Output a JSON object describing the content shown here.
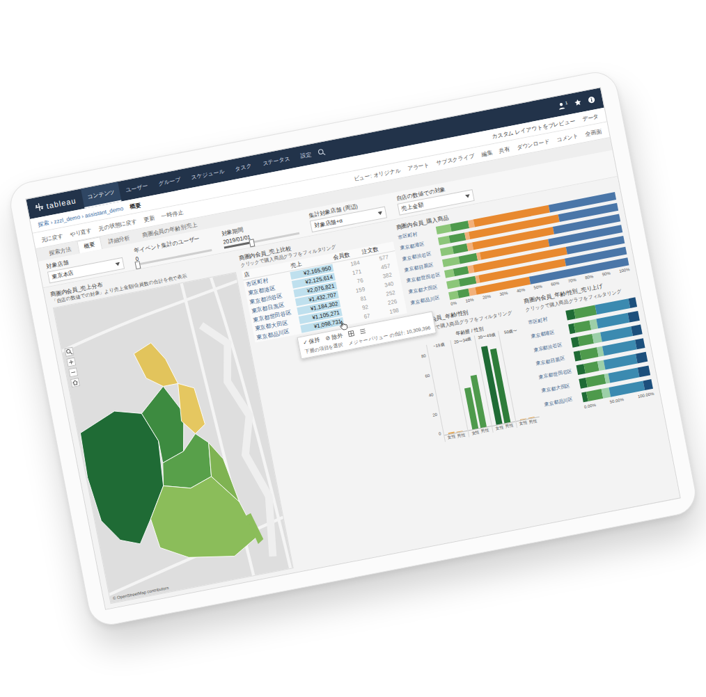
{
  "header": {
    "logo": "tableau",
    "nav": [
      {
        "label": "コンテンツ",
        "selected": true
      },
      {
        "label": "ユーザー",
        "selected": false
      },
      {
        "label": "グループ",
        "selected": false
      },
      {
        "label": "スケジュール",
        "selected": false
      },
      {
        "label": "タスク",
        "selected": false
      },
      {
        "label": "ステータス",
        "selected": false
      },
      {
        "label": "設定",
        "selected": false
      }
    ],
    "user_badge": "1"
  },
  "breadcrumb": {
    "path": "探索 › zzzl_demo › assistant_demo",
    "view": "概要"
  },
  "toolbar": {
    "left": [
      "元に戻す",
      "やり直す",
      "元の状態に戻す",
      "更新",
      "一時停止"
    ],
    "right": [
      "ビュー: オリジナル",
      "アラート",
      "サブスクライブ",
      "編集",
      "共有",
      "ダウンロード",
      "コメント",
      "全画面"
    ],
    "top_right": [
      "カスタム レイアウトをプレビュー",
      "データ"
    ]
  },
  "sheet_tabs": [
    {
      "label": "探索方法",
      "selected": false
    },
    {
      "label": "概要",
      "selected": true
    },
    {
      "label": "詳細分析",
      "selected": false
    },
    {
      "label": "商圏会員の年齢別売上",
      "selected": false
    }
  ],
  "filters": [
    {
      "kind": "dropdown",
      "label": "対象店舗",
      "value": "東京本店"
    },
    {
      "kind": "slider",
      "label": "年イベント集計のユーザー",
      "value": "0",
      "level": 0.0
    },
    {
      "kind": "slider",
      "label": "対象期間",
      "value": "2019/01/01",
      "level": 0.35
    },
    {
      "kind": "dropdown",
      "label": "集計対象店舗 (周辺)",
      "value": "対象店舗+α"
    },
    {
      "kind": "dropdown",
      "label": "自店の数値での対象",
      "value": "売上金額"
    }
  ],
  "map": {
    "title": "商圏内会員_売上分布",
    "subtitle": "「自店の数値での対象」より売上金額/会員数の合計を色で表示",
    "regions": [
      {
        "color": "#1f6b35"
      },
      {
        "color": "#3d8b40"
      },
      {
        "color": "#e2c45c"
      },
      {
        "color": "#e5c760"
      },
      {
        "color": "#58a04a"
      },
      {
        "color": "#8bbd5a"
      },
      {
        "color": "#7fb352"
      }
    ],
    "credit": "© OpenStreetMap contributors"
  },
  "table": {
    "title": "商圏内会員_売上比較",
    "subtitle": "クリックで購入商品グラフをフィルタリング",
    "columns": [
      "店",
      "売上",
      "会員数",
      "注文数"
    ],
    "rows": [
      {
        "name": "市区町村",
        "sales": "¥2,165,950",
        "members": "184",
        "orders": "577",
        "selected": true
      },
      {
        "name": "東京都港区",
        "sales": "¥2,125,614",
        "members": "171",
        "orders": "457",
        "selected": true
      },
      {
        "name": "東京都渋谷区",
        "sales": "¥2,076,821",
        "members": "76",
        "orders": "382",
        "selected": true
      },
      {
        "name": "東京都目黒区",
        "sales": "¥1,432,707",
        "members": "159",
        "orders": "340",
        "selected": true
      },
      {
        "name": "東京都世田谷区",
        "sales": "¥1,184,302",
        "members": "81",
        "orders": "252",
        "selected": true
      },
      {
        "name": "東京都大田区",
        "sales": "¥1,105,271",
        "members": "92",
        "orders": "226",
        "selected": true
      },
      {
        "name": "東京都品川区",
        "sales": "¥1,098,731",
        "members": "67",
        "orders": "198",
        "selected": true
      }
    ]
  },
  "tooltip": {
    "actions": [
      "✓ 保持",
      "⊘ 除外"
    ],
    "hint": "下層の項目を選択",
    "summary": "メジャー バリュー の合計: 10,309,396"
  },
  "purchase_chart": {
    "title": "商圏内会員_購入商品",
    "series": [
      {
        "color": "#8cc679"
      },
      {
        "color": "#4e9a4c"
      },
      {
        "color": "#f2b07a"
      },
      {
        "color": "#e8892f"
      },
      {
        "color": "#4a76a8"
      }
    ],
    "rows": [
      {
        "label": "市区町村",
        "values": [
          8,
          10,
          3,
          42,
          37
        ]
      },
      {
        "label": "東京都港区",
        "values": [
          6,
          9,
          2,
          50,
          33
        ]
      },
      {
        "label": "東京都渋谷区",
        "values": [
          7,
          8,
          3,
          45,
          37
        ]
      },
      {
        "label": "東京都目黒区",
        "values": [
          9,
          10,
          2,
          38,
          41
        ]
      },
      {
        "label": "東京都世田谷区",
        "values": [
          5,
          8,
          3,
          52,
          32
        ]
      },
      {
        "label": "東京都大田区",
        "values": [
          7,
          9,
          2,
          48,
          34
        ]
      },
      {
        "label": "東京都品川区",
        "values": [
          5,
          6,
          4,
          30,
          55
        ]
      }
    ],
    "ticks": [
      "0%",
      "10%",
      "20%",
      "30%",
      "40%",
      "50%",
      "60%",
      "70%",
      "80%",
      "90%",
      "100%"
    ]
  },
  "age_chart": {
    "title": "商圏内会員_年齢/性別",
    "subtitle": "クリックで購入商品グラフをフィルタリング",
    "axis_title": "年齢層 / 性別",
    "y_ticks": [
      "80",
      "60",
      "40",
      "20",
      "0"
    ],
    "max": 100,
    "groups": [
      {
        "label": "~19歳",
        "bars": [
          {
            "label": "女性",
            "value": 2,
            "color": "#e3a857"
          },
          {
            "label": "男性",
            "value": 1,
            "color": "#e3a857"
          }
        ]
      },
      {
        "label": "20〜34歳",
        "bars": [
          {
            "label": "女性",
            "value": 50,
            "color": "#4e9a4c"
          },
          {
            "label": "男性",
            "value": 63,
            "color": "#4e9a4c"
          }
        ]
      },
      {
        "label": "35〜49歳",
        "bars": [
          {
            "label": "女性",
            "value": 95,
            "color": "#1f6b35"
          },
          {
            "label": "男性",
            "value": 90,
            "color": "#2e7d3a"
          }
        ]
      },
      {
        "label": "50歳〜",
        "bars": [
          {
            "label": "女性",
            "value": 1,
            "color": "#e3a857"
          },
          {
            "label": "男性",
            "value": 1,
            "color": "#e3a857"
          }
        ]
      }
    ]
  },
  "age_sales_chart": {
    "title": "商圏内会員_年齢/性別_売り上げ",
    "subtitle": "クリックで購入商品グラフをフィルタリング",
    "series": [
      {
        "color": "#1f6b35"
      },
      {
        "color": "#4e9a4c"
      },
      {
        "color": "#9ccfa8"
      },
      {
        "color": "#3b8ab0"
      },
      {
        "color": "#1c4f7c"
      }
    ],
    "rows": [
      {
        "label": "市区町村",
        "values": [
          12,
          30,
          0,
          48,
          10
        ]
      },
      {
        "label": "東京都港区",
        "values": [
          8,
          22,
          10,
          45,
          15
        ]
      },
      {
        "label": "東京都渋谷区",
        "values": [
          10,
          20,
          12,
          44,
          14
        ]
      },
      {
        "label": "東京都目黒区",
        "values": [
          9,
          24,
          8,
          47,
          12
        ]
      },
      {
        "label": "東京都世田谷区",
        "values": [
          11,
          19,
          9,
          46,
          15
        ]
      },
      {
        "label": "東京都大田区",
        "values": [
          10,
          26,
          6,
          42,
          16
        ]
      },
      {
        "label": "東京都品川区",
        "values": [
          7,
          21,
          11,
          49,
          12
        ]
      }
    ],
    "ticks": [
      "0.00%",
      "50.00%",
      "100.00%"
    ]
  }
}
